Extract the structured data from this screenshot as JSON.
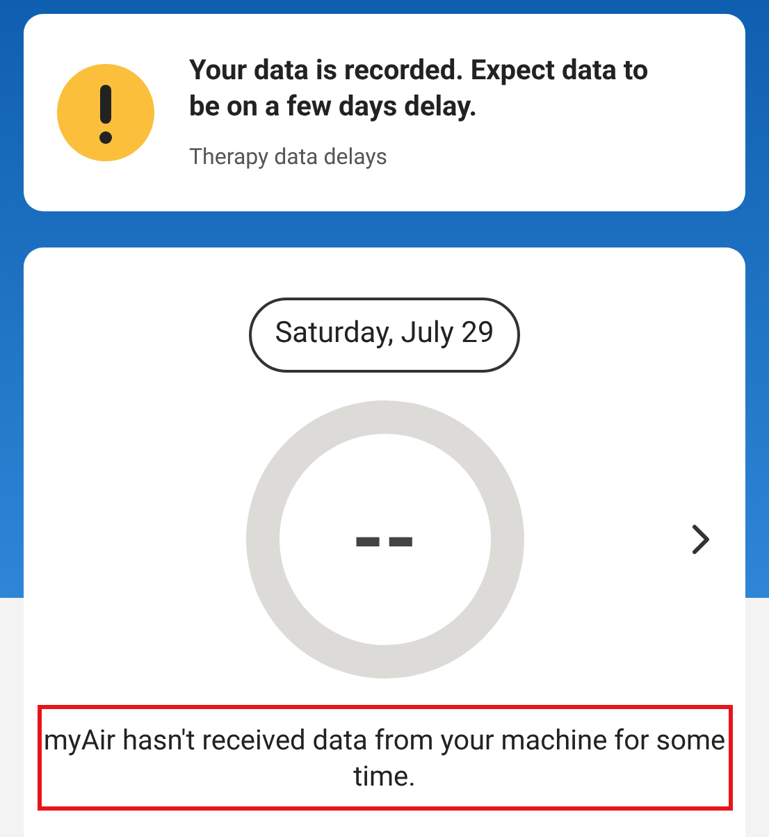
{
  "notice": {
    "title": "Your data is recorded. Expect data to be on a few days delay.",
    "subtitle": "Therapy data delays"
  },
  "day_card": {
    "date": "Saturday, July 29",
    "score": "--",
    "level": 0,
    "message": "myAir hasn't received data from your machine for some time.",
    "highlighted": true
  }
}
